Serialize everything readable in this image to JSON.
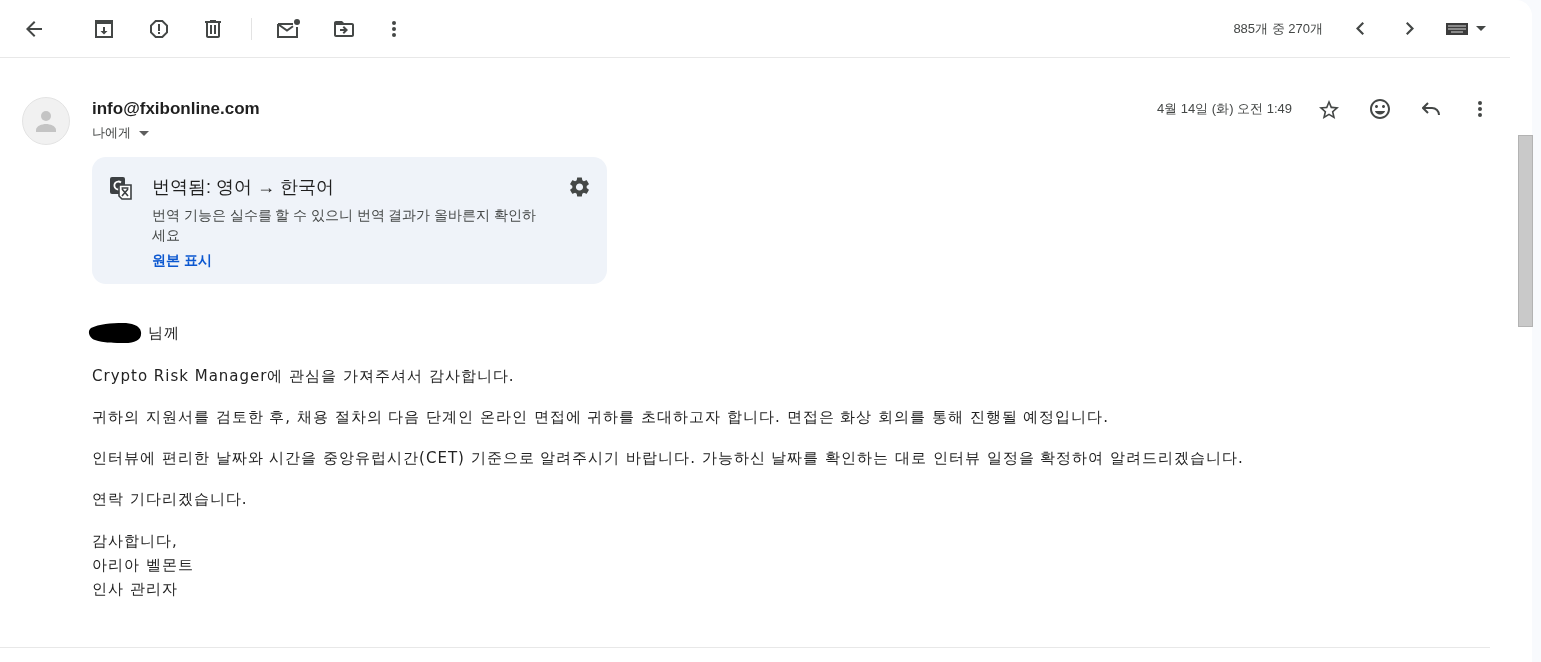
{
  "toolbar": {
    "count": "885개 중 270개"
  },
  "message": {
    "sender": "info@fxibonline.com",
    "recipient": "나에게",
    "date": "4월 14일 (화) 오전 1:49",
    "starred": false
  },
  "translation_banner": {
    "title": "번역됨: 영어 → 한국어",
    "notice": "번역 기능은 실수를 할 수 있으니 번역 결과가 올바른지 확인하세요",
    "link": "원본 표시"
  },
  "body": {
    "greeting": {
      "text": "님께",
      "name_redacted": true
    },
    "paragraphs": [
      "Crypto Risk Manager에 관심을 가져주셔서 감사합니다.",
      "귀하의 지원서를 검토한 후, 채용 절차의 다음 단계인 온라인 면접에 귀하를 초대하고자 합니다. 면접은 화상 회의를 통해 진행될 예정입니다.",
      "인터뷰에 편리한 날짜와 시간을 중앙유럽시간(CET) 기준으로 알려주시기 바랍니다. 가능하신 날짜를 확인하는 대로 인터뷰 일정을 확정하여 알려드리겠습니다.",
      "연락 기다리겠습니다."
    ],
    "signature": [
      "감사합니다,",
      "아리아 벨몬트",
      "인사 관리자"
    ]
  }
}
